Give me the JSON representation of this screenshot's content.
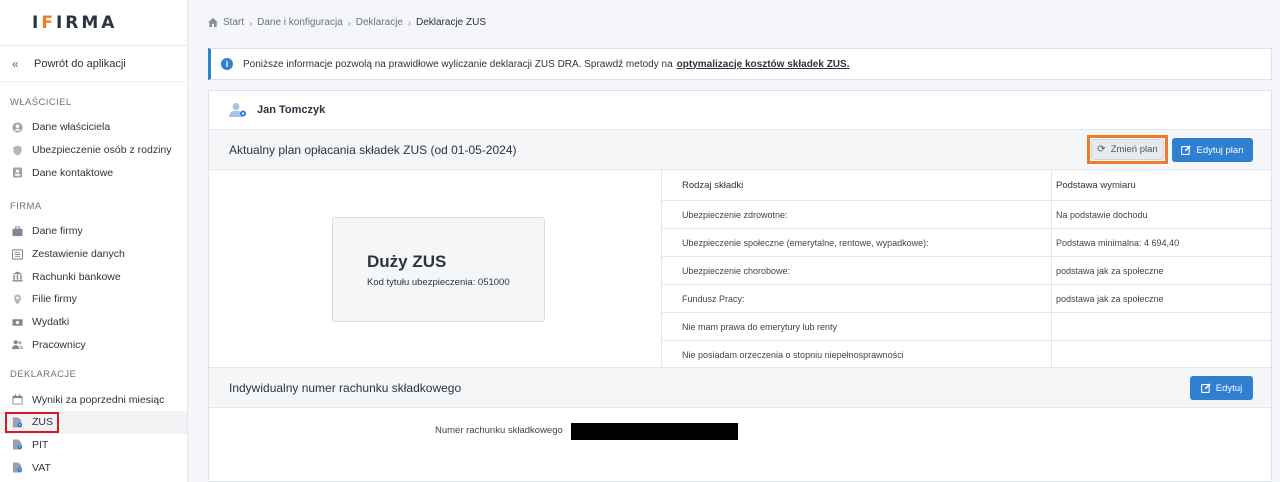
{
  "logo": {
    "text": "IFIRMA"
  },
  "sidebar": {
    "back_label": "Powrót do aplikacji",
    "sections": [
      {
        "title": "WŁAŚCICIEL",
        "items": [
          {
            "label": "Dane właściciela",
            "icon": "user-circle-icon"
          },
          {
            "label": "Ubezpieczenie osób z rodziny",
            "icon": "shield-icon"
          },
          {
            "label": "Dane kontaktowe",
            "icon": "contact-card-icon"
          }
        ]
      },
      {
        "title": "FIRMA",
        "items": [
          {
            "label": "Dane firmy",
            "icon": "briefcase-icon"
          },
          {
            "label": "Zestawienie danych",
            "icon": "list-icon"
          },
          {
            "label": "Rachunki bankowe",
            "icon": "bank-icon"
          },
          {
            "label": "Filie firmy",
            "icon": "map-pin-icon"
          },
          {
            "label": "Wydatki",
            "icon": "money-icon"
          },
          {
            "label": "Pracownicy",
            "icon": "users-icon"
          }
        ]
      },
      {
        "title": "DEKLARACJE",
        "items": [
          {
            "label": "Wyniki za poprzedni miesiąc",
            "icon": "calendar-icon"
          },
          {
            "label": "ZUS",
            "icon": "declaration-icon"
          },
          {
            "label": "PIT",
            "icon": "declaration-icon"
          },
          {
            "label": "VAT",
            "icon": "declaration-icon"
          }
        ]
      }
    ]
  },
  "breadcrumb": {
    "items": [
      "Start",
      "Dane i konfiguracja",
      "Deklaracje",
      "Deklaracje ZUS"
    ]
  },
  "info": {
    "text": "Poniższe informacje pozwolą na prawidłowe wyliczanie deklaracji ZUS DRA. Sprawdź metody na",
    "link": "optymalizację kosztów składek ZUS."
  },
  "person": {
    "name": "Jan Tomczyk"
  },
  "plan": {
    "title": "Aktualny plan opłacania składek ZUS (od 01-05-2024)",
    "change_label": "Zmień plan",
    "edit_label": "Edytuj plan",
    "card_title": "Duży ZUS",
    "card_sub": "Kod tytułu ubezpieczenia: 051000",
    "table": {
      "headers": [
        "Rodzaj składki",
        "Podstawa wymiaru"
      ],
      "rows": [
        [
          "Ubezpieczenie zdrowotne:",
          "Na podstawie dochodu"
        ],
        [
          "Ubezpieczenie społeczne (emerytalne, rentowe, wypadkowe):",
          "Podstawa minimalna: 4 694,40"
        ],
        [
          "Ubezpieczenie chorobowe:",
          "podstawa jak za społeczne"
        ],
        [
          "Fundusz Pracy:",
          "podstawa jak za społeczne"
        ],
        [
          "Nie mam prawa do emerytury lub renty",
          ""
        ],
        [
          "Nie posiadam orzeczenia o stopniu niepełnosprawności",
          ""
        ]
      ]
    }
  },
  "account": {
    "title": "Indywidualny numer rachunku składkowego",
    "edit_label": "Edytuj",
    "label": "Numer rachunku składkowego"
  }
}
